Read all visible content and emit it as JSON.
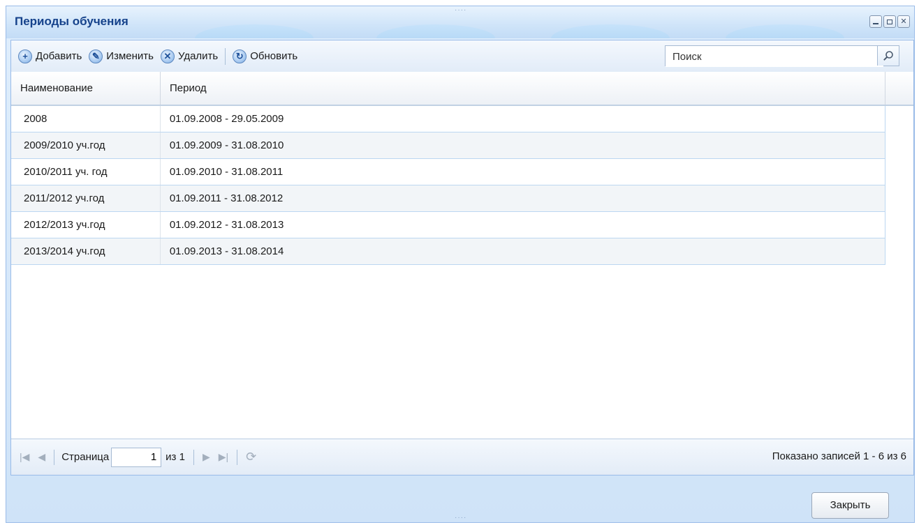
{
  "window": {
    "title": "Периоды обучения",
    "controls": [
      "minimize-icon",
      "maximize-icon",
      "close-icon"
    ]
  },
  "toolbar": {
    "add_label": "Добавить",
    "edit_label": "Изменить",
    "delete_label": "Удалить",
    "refresh_label": "Обновить",
    "search_placeholder": "Поиск"
  },
  "grid": {
    "columns": [
      "Наименование",
      "Период"
    ],
    "rows": [
      {
        "name": "2008",
        "period": "01.09.2008 - 29.05.2009"
      },
      {
        "name": "2009/2010 уч.год",
        "period": "01.09.2009 - 31.08.2010"
      },
      {
        "name": "2010/2011 уч. год",
        "period": "01.09.2010 - 31.08.2011"
      },
      {
        "name": "2011/2012 уч.год",
        "period": "01.09.2011 - 31.08.2012"
      },
      {
        "name": "2012/2013 уч.год",
        "period": "01.09.2012 - 31.08.2013"
      },
      {
        "name": "2013/2014 уч.год",
        "period": "01.09.2013 - 31.08.2014"
      }
    ]
  },
  "pager": {
    "page_label": "Страница",
    "page_value": "1",
    "of_label": "из 1",
    "info": "Показано записей 1 - 6 из 6"
  },
  "footer": {
    "close_label": "Закрыть"
  },
  "colors": {
    "title_text": "#15428b",
    "border": "#99bbe8",
    "row_border": "#bcd7f1"
  }
}
